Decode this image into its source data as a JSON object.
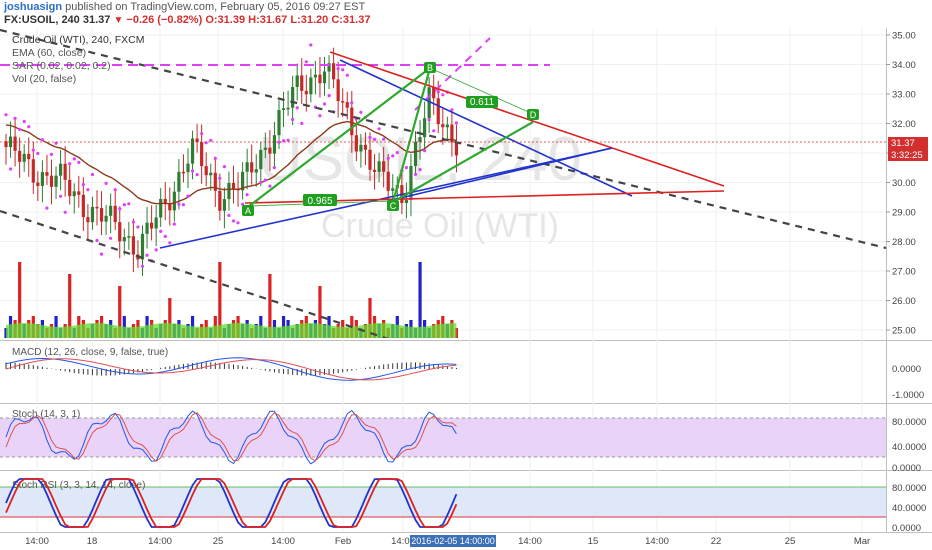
{
  "header": {
    "user": "joshuasign",
    "published_text": "published on TradingView.com, February 05, 2016 09:27 EST",
    "symbol": "FX:USOIL, 240",
    "last": "31.37",
    "change": "−0.26 (−0.82%)",
    "open": "O:31.39",
    "high": "H:31.67",
    "low": "L:31.20",
    "close": "C:31.37"
  },
  "legend": {
    "title": "Crude Oil (WTI), 240, FXCM",
    "ema": "EMA (60, close)",
    "sar": "SAR (0.02, 0.02, 0.2)",
    "vol": "Vol (20, false)"
  },
  "watermark": {
    "symbol": "USOIL, 240",
    "name": "Crude Oil (WTI)"
  },
  "price_axis": {
    "ticks": [
      "35.00",
      "34.00",
      "33.00",
      "32.00",
      "31.00",
      "30.00",
      "29.00",
      "28.00",
      "27.00",
      "26.00",
      "25.00"
    ],
    "current_price": "31.37",
    "countdown": "3:32:25"
  },
  "time_axis": {
    "labels": [
      "14:00",
      "18",
      "14:00",
      "25",
      "14:00",
      "Feb",
      "14:00",
      "14:00",
      "15",
      "14:00",
      "22",
      "25",
      "Mar"
    ],
    "cursor_label": "2016-02-05 14:00:00"
  },
  "annotations": {
    "points": [
      "A",
      "B",
      "C",
      "D"
    ],
    "fib_values": [
      "0.611",
      "0.965"
    ]
  },
  "panes": {
    "macd": {
      "title": "MACD (12, 26, close, 9, false, true)",
      "ticks": [
        "0.0000",
        "-1.0000"
      ]
    },
    "stoch": {
      "title": "Stoch (14, 3, 1)",
      "ticks": [
        "80.0000",
        "40.0000",
        "0.0000"
      ]
    },
    "stochrsi": {
      "title": "Stoch RSI (3, 3, 14, 14, close)",
      "ticks": [
        "80.0000",
        "40.0000",
        "0.0000"
      ]
    }
  },
  "colors": {
    "up": "#2e7d32",
    "down": "#c62828",
    "ema": "#8b3a1a",
    "sar": "#e040fb",
    "blue_line": "#2233cc",
    "green_line": "#2ea82e",
    "red_line": "#dd2222",
    "label_bg": "#1f9e1f"
  },
  "chart_data": {
    "type": "candlestick",
    "title": "Crude Oil (WTI), 240, FXCM",
    "ylim": [
      24.8,
      35.1
    ],
    "approx_close_path": [
      [
        "Jan 13",
        31.2
      ],
      [
        "Jan 14",
        30.4
      ],
      [
        "Jan 15",
        30.1
      ],
      [
        "Jan 18",
        29.2
      ],
      [
        "Jan 19",
        28.6
      ],
      [
        "Jan 20",
        27.8
      ],
      [
        "Jan 21",
        29.2
      ],
      [
        "Jan 22",
        31.2
      ],
      [
        "Jan 25",
        29.6
      ],
      [
        "Jan 26",
        30.0
      ],
      [
        "Jan 27",
        31.6
      ],
      [
        "Jan 28",
        33.2
      ],
      [
        "Jan 29",
        33.9
      ],
      [
        "Feb 1",
        32.0
      ],
      [
        "Feb 2",
        30.2
      ],
      [
        "Feb 3",
        29.6
      ],
      [
        "Feb 4",
        32.8
      ],
      [
        "Feb 5",
        31.37
      ]
    ],
    "volume_levels": [
      "low",
      "mid",
      "high"
    ]
  }
}
